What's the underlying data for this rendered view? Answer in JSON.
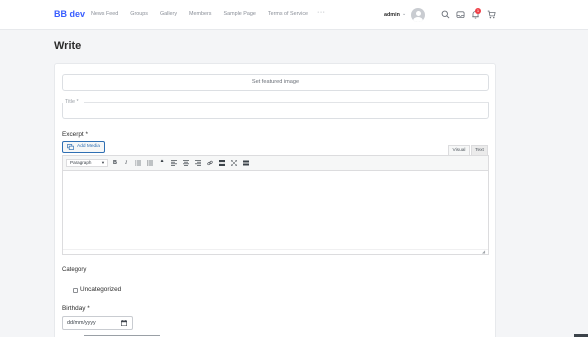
{
  "site": {
    "logo": "BB dev"
  },
  "nav": {
    "items": [
      "News Feed",
      "Groups",
      "Gallery",
      "Members",
      "Sample Page",
      "Terms of Service"
    ],
    "more": "···"
  },
  "user": {
    "name": "admin",
    "notification_count": "1"
  },
  "icons": {
    "search": "search-icon",
    "messages": "inbox-icon",
    "notifications": "bell-icon",
    "cart": "cart-icon"
  },
  "page": {
    "title": "Write"
  },
  "form": {
    "featured_image": "Set featured image",
    "title_label": "Title *",
    "excerpt_label": "Excerpt *",
    "add_media": "Add Media",
    "tab_visual": "Visual",
    "tab_text": "Text",
    "format_select": "Paragraph",
    "category_label": "Category",
    "category_option": "Uncategorized",
    "birthday_label": "Birthday *",
    "date_placeholder": "dd/mm/yyyy"
  },
  "toolbar": {
    "bold": "B",
    "italic": "I",
    "quote": "❝"
  },
  "colors": {
    "brand": "#385dff",
    "badge": "#ef3e46",
    "add_media": "#2f6fb3"
  }
}
